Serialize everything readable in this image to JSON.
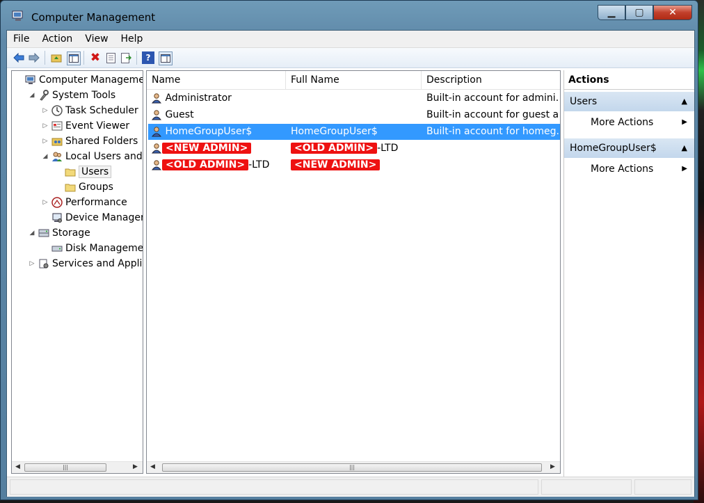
{
  "window": {
    "title": "Computer Management",
    "min_glyph": "▁",
    "max_glyph": "▢",
    "close_glyph": "✕"
  },
  "menu": [
    "File",
    "Action",
    "View",
    "Help"
  ],
  "tree": [
    {
      "label": "Computer Management",
      "depth": 0,
      "twisty": "",
      "icon": "computer-management-icon"
    },
    {
      "label": "System Tools",
      "depth": 1,
      "twisty": "◢",
      "icon": "system-tools-icon"
    },
    {
      "label": "Task Scheduler",
      "depth": 2,
      "twisty": "▷",
      "icon": "clock-icon"
    },
    {
      "label": "Event Viewer",
      "depth": 2,
      "twisty": "▷",
      "icon": "event-viewer-icon"
    },
    {
      "label": "Shared Folders",
      "depth": 2,
      "twisty": "▷",
      "icon": "shared-folder-icon"
    },
    {
      "label": "Local Users and Gro",
      "depth": 2,
      "twisty": "◢",
      "icon": "users-icon"
    },
    {
      "label": "Users",
      "depth": 3,
      "twisty": "",
      "icon": "folder-icon",
      "selected": true
    },
    {
      "label": "Groups",
      "depth": 3,
      "twisty": "",
      "icon": "folder-icon"
    },
    {
      "label": "Performance",
      "depth": 2,
      "twisty": "▷",
      "icon": "performance-icon"
    },
    {
      "label": "Device Manager",
      "depth": 2,
      "twisty": "",
      "icon": "device-manager-icon"
    },
    {
      "label": "Storage",
      "depth": 1,
      "twisty": "◢",
      "icon": "storage-icon"
    },
    {
      "label": "Disk Management",
      "depth": 2,
      "twisty": "",
      "icon": "disk-icon"
    },
    {
      "label": "Services and Applicat",
      "depth": 1,
      "twisty": "▷",
      "icon": "services-icon"
    }
  ],
  "list": {
    "columns": [
      "Name",
      "Full Name",
      "Description"
    ],
    "rows": [
      {
        "name": "Administrator",
        "full": "",
        "desc": "Built-in account for admini..."
      },
      {
        "name": "Guest",
        "full": "",
        "desc": "Built-in account for guest a..."
      },
      {
        "name": "HomeGroupUser$",
        "full": "HomeGroupUser$",
        "desc": "Built-in account for homeg...",
        "selected": true
      },
      {
        "name_redact": "<NEW ADMIN>",
        "full_redact": "<OLD ADMIN>",
        "full_suffix": "-LTD"
      },
      {
        "name_redact": "<OLD ADMIN>",
        "name_suffix": "-LTD",
        "full_redact": "<NEW ADMIN>"
      }
    ]
  },
  "actions": {
    "title": "Actions",
    "sections": [
      {
        "header": "Users",
        "item": "More Actions"
      },
      {
        "header": "HomeGroupUser$",
        "item": "More Actions"
      }
    ]
  },
  "colors": {
    "selection": "#3399ff",
    "redaction": "#ee1111"
  }
}
